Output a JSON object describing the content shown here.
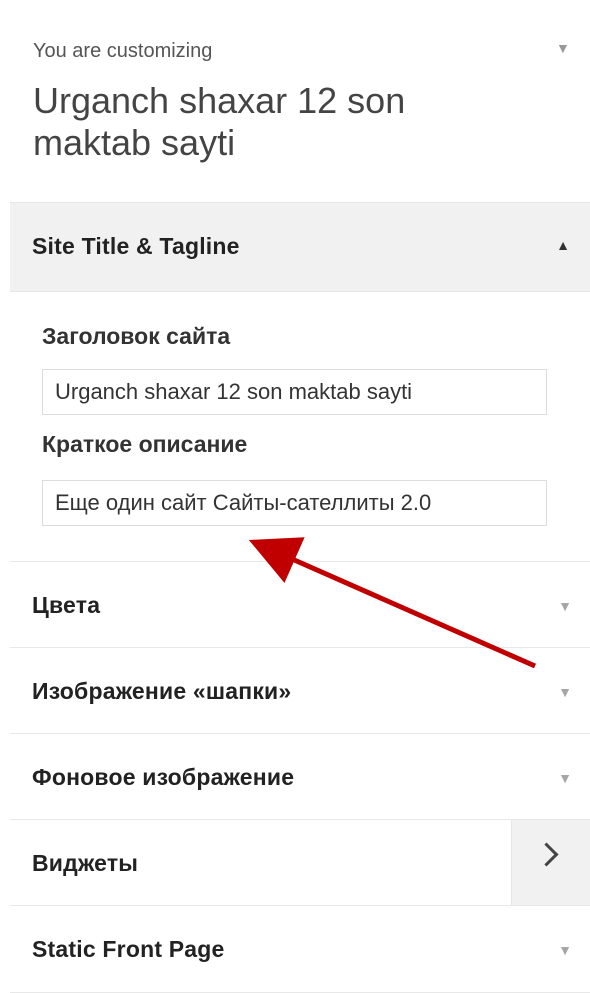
{
  "header": {
    "preface": "You are customizing",
    "site_name": "Urganch shaxar 12 son maktab sayti"
  },
  "open_section": {
    "title": "Site Title & Tagline",
    "fields": [
      {
        "label": "Заголовок сайта",
        "value": "Urganch shaxar 12 son maktab sayti"
      },
      {
        "label": "Краткое описание",
        "value": "Еще один сайт Сайты-сателлиты 2.0"
      }
    ]
  },
  "sections": [
    {
      "title": "Цвета"
    },
    {
      "title": "Изображение «шапки»"
    },
    {
      "title": "Фоновое изображение"
    },
    {
      "title": "Виджеты"
    },
    {
      "title": "Static Front Page"
    }
  ],
  "icons": {
    "collapse": "triangle-down-icon",
    "expanded": "triangle-up-icon",
    "navigate": "chevron-right-icon"
  },
  "colors": {
    "annotation_arrow": "#c00000"
  }
}
